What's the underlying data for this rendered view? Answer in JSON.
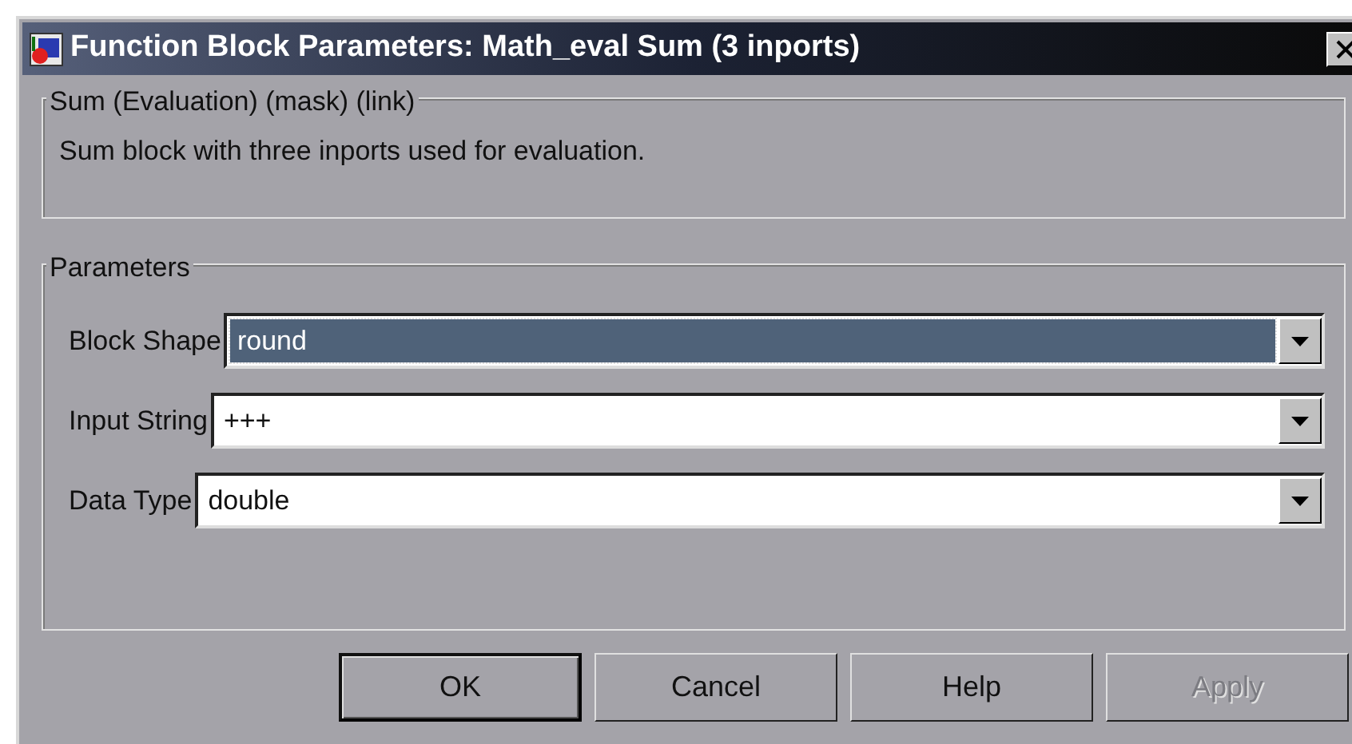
{
  "window": {
    "title": "Function Block Parameters: Math_eval Sum (3 inports)"
  },
  "description_group": {
    "title": "Sum (Evaluation) (mask) (link)",
    "text": "Sum block with three inports used for evaluation."
  },
  "parameters_group": {
    "title": "Parameters",
    "fields": [
      {
        "label": "Block Shape",
        "value": "round",
        "focused": true
      },
      {
        "label": "Input String",
        "value": "+++",
        "focused": false
      },
      {
        "label": "Data Type",
        "value": "double",
        "focused": false
      }
    ]
  },
  "buttons": [
    {
      "label": "OK",
      "default": true,
      "disabled": false
    },
    {
      "label": "Cancel",
      "default": false,
      "disabled": false
    },
    {
      "label": "Help",
      "default": false,
      "disabled": false
    },
    {
      "label": "Apply",
      "default": false,
      "disabled": true
    }
  ]
}
